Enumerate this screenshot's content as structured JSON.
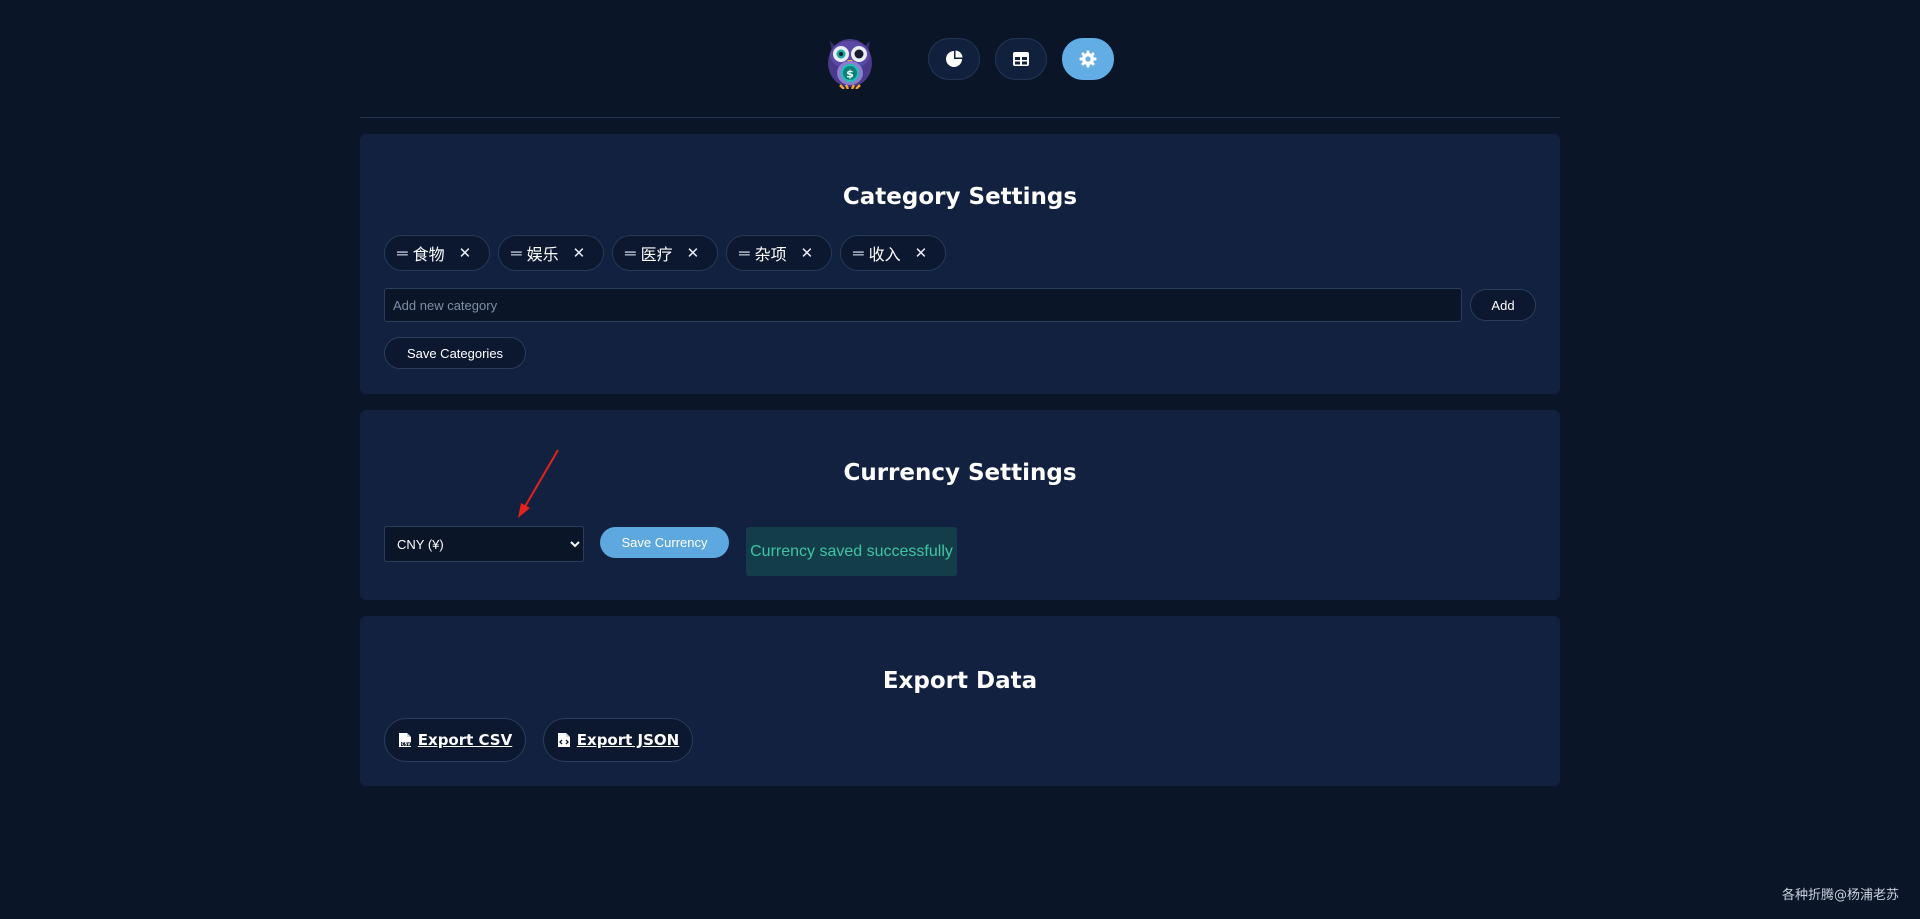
{
  "colors": {
    "background": "#0a1628",
    "panel": "#12213f",
    "accent": "#63ade5",
    "success_text": "#3ec6a2",
    "success_bg": "#143d4a",
    "annotation_arrow": "#e0231b"
  },
  "header": {
    "logo_icon": "owl-dollar-logo",
    "nav": [
      {
        "icon": "pie-chart-icon",
        "active": false
      },
      {
        "icon": "table-icon",
        "active": false
      },
      {
        "icon": "gear-icon",
        "active": true
      }
    ]
  },
  "category_settings": {
    "title": "Category Settings",
    "categories": [
      {
        "label": "食物",
        "drag_glyph": "═",
        "remove_glyph": "✕"
      },
      {
        "label": "娱乐",
        "drag_glyph": "═",
        "remove_glyph": "✕"
      },
      {
        "label": "医疗",
        "drag_glyph": "═",
        "remove_glyph": "✕"
      },
      {
        "label": "杂项",
        "drag_glyph": "═",
        "remove_glyph": "✕"
      },
      {
        "label": "收入",
        "drag_glyph": "═",
        "remove_glyph": "✕"
      }
    ],
    "new_category_placeholder": "Add new category",
    "new_category_value": "",
    "add_label": "Add",
    "save_label": "Save Categories"
  },
  "currency_settings": {
    "title": "Currency Settings",
    "selected": "CNY (¥)",
    "save_label": "Save Currency",
    "status": "Currency saved successfully"
  },
  "export_data": {
    "title": "Export Data",
    "csv_label": "Export CSV",
    "json_label": "Export JSON"
  },
  "watermark": "各种折腾@杨浦老苏"
}
